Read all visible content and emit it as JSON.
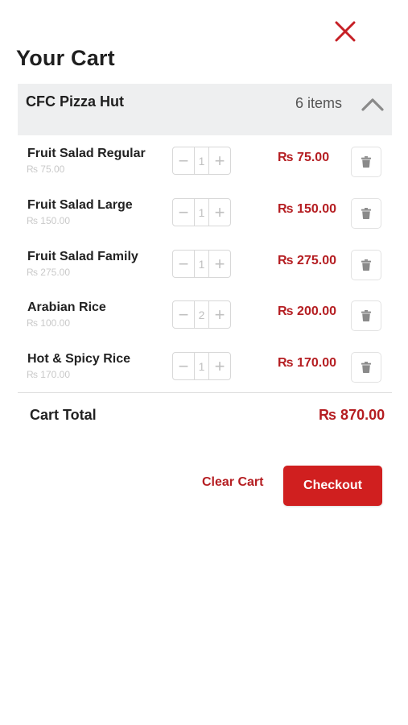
{
  "header": {
    "title": "Your Cart",
    "close_icon": "close-icon"
  },
  "restaurant": {
    "name": "CFC Pizza Hut",
    "item_count": "6 items",
    "collapse_icon": "chevron-up-icon"
  },
  "items": [
    {
      "name": "Fruit Salad Regular",
      "unit_price": "₨ 75.00",
      "quantity": "1",
      "total": "₨ 75.00"
    },
    {
      "name": "Fruit Salad Large",
      "unit_price": "₨ 150.00",
      "quantity": "1",
      "total": "₨ 150.00"
    },
    {
      "name": "Fruit Salad Family",
      "unit_price": "₨ 275.00",
      "quantity": "1",
      "total": "₨ 275.00"
    },
    {
      "name": "Arabian Rice",
      "unit_price": "₨ 100.00",
      "quantity": "2",
      "total": "₨ 200.00"
    },
    {
      "name": "Hot & Spicy Rice",
      "unit_price": "₨ 170.00",
      "quantity": "1",
      "total": "₨ 170.00"
    }
  ],
  "stepper": {
    "minus": "−",
    "plus": "+"
  },
  "summary": {
    "label": "Cart Total",
    "value": "₨ 870.00"
  },
  "actions": {
    "clear_label": "Clear Cart",
    "checkout_label": "Checkout"
  },
  "colors": {
    "accent": "#d01f1f",
    "price": "#b51e22",
    "bar_bg": "#eeeff0"
  }
}
